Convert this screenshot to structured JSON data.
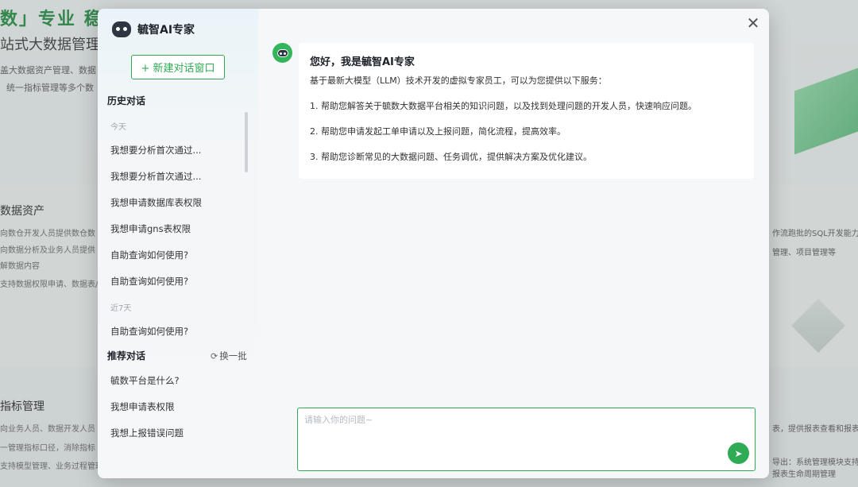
{
  "background": {
    "hero_title": "数」专业  稳",
    "hero_sub": "站式大数据管理",
    "hero_desc1": "盖大数据资产管理、数据",
    "hero_desc2": "统一指标管理等多个数",
    "section_assets": "数据资产",
    "assets_lines": [
      "向数仓开发人员提供数仓数",
      "向数据分析及业务人员提供",
      "解数据内容",
      "支持数据权限申请、数据表/字"
    ],
    "section_metrics": "指标管理",
    "metrics_lines": [
      "向业务人员、数据开发人员",
      "一管理指标口径，消除指标",
      "支持模型管理、业务过程管理"
    ],
    "right_lines": [
      "作流跑批的SQL开发能力",
      "管理、项目管理等",
      "表，提供报表查看和报表",
      "导出：系统管理模块支持",
      "报表生命周期管理"
    ]
  },
  "modal": {
    "brand_name": "毓智AI专家",
    "new_chat_label": "+ 新建对话窗口",
    "history_title": "历史对话",
    "groups": [
      {
        "label": "今天",
        "items": [
          "我想要分析首次通过...",
          "我想要分析首次通过...",
          "我想申请数据库表权限",
          "我想申请gns表权限",
          "自助查询如何使用?",
          "自助查询如何使用?"
        ]
      },
      {
        "label": "近7天",
        "items": [
          "自助查询如何使用?"
        ]
      }
    ],
    "recommend_title": "推荐对话",
    "refresh_label": "换一批",
    "recommend_items": [
      "毓数平台是什么?",
      "我想申请表权限",
      "我想上报错误问题"
    ],
    "message": {
      "title": "您好，我是毓智AI专家",
      "intro": "基于最新大模型（LLM）技术开发的虚拟专家员工，可以为您提供以下服务：",
      "items": [
        "1. 帮助您解答关于毓数大数据平台相关的知识问题，以及找到处理问题的开发人员，快速响应问题。",
        "2. 帮助您申请发起工单申请以及上报问题，简化流程，提高效率。",
        "3. 帮助您诊断常见的大数据问题、任务调优，提供解决方案及优化建议。"
      ]
    },
    "input": {
      "placeholder": "请输入你的问题~",
      "value": ""
    },
    "close_symbol": "✕",
    "send_symbol": "➤"
  },
  "colors": {
    "accent": "#2faa55",
    "bot_avatar": "#34b55c"
  }
}
